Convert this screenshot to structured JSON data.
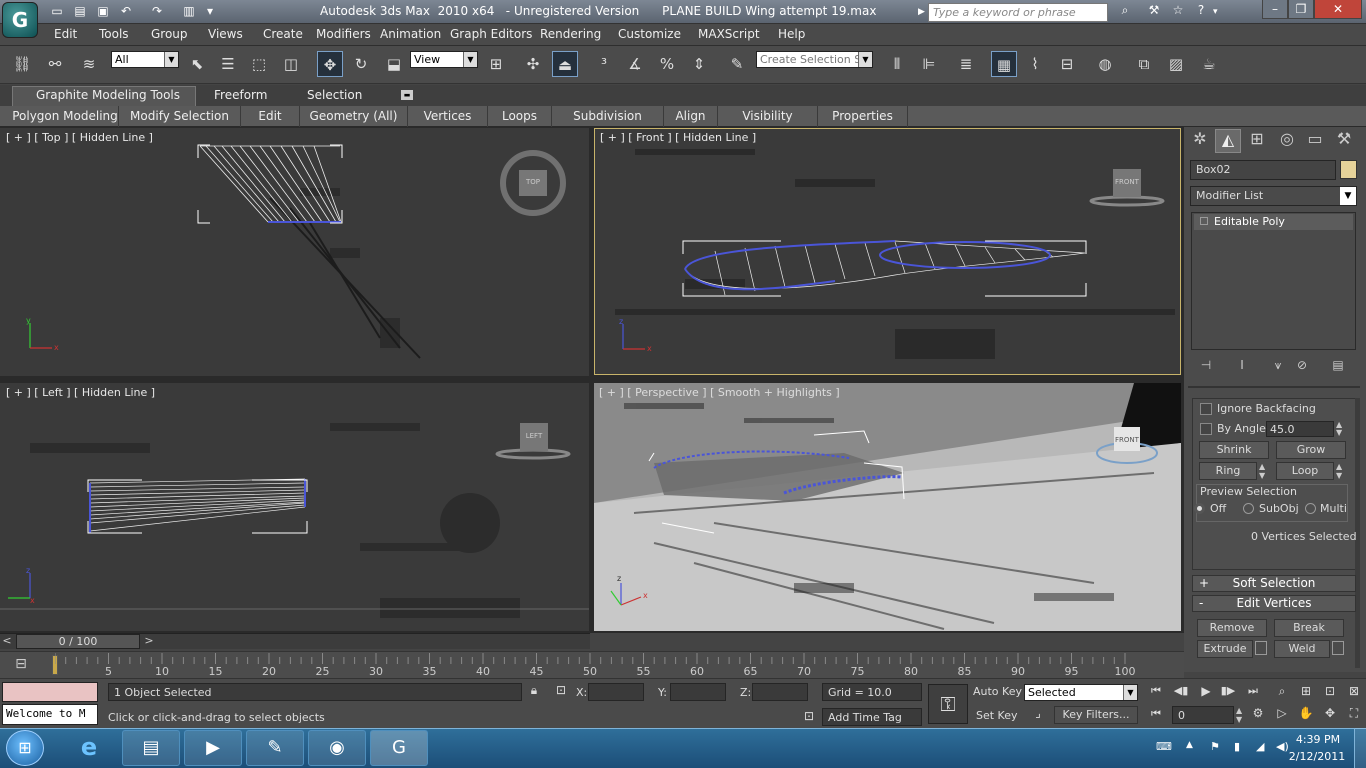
{
  "window": {
    "title": "Autodesk 3ds Max  2010 x64   - Unregistered Version      PLANE BUILD Wing attempt 19.max",
    "search_placeholder": "Type a keyword or phrase"
  },
  "menu": [
    "Edit",
    "Tools",
    "Group",
    "Views",
    "Create",
    "Modifiers",
    "Animation",
    "Graph Editors",
    "Rendering",
    "Customize",
    "MAXScript",
    "Help"
  ],
  "toolbar": {
    "filter_value": "All",
    "refcoord_value": "View",
    "selection_set_placeholder": "Create Selection Se"
  },
  "ribbon": {
    "tabs": [
      "Graphite Modeling Tools",
      "Freeform",
      "Selection"
    ],
    "panels": [
      "Polygon Modeling",
      "Modify Selection",
      "Edit",
      "Geometry (All)",
      "Vertices",
      "Loops",
      "Subdivision",
      "Align",
      "Visibility",
      "Properties"
    ]
  },
  "viewports": {
    "top": {
      "label": "[ + ] [ Top ] [ Hidden Line ]",
      "cube": "TOP"
    },
    "front": {
      "label": "[ + ] [ Front ] [ Hidden Line ]",
      "cube": "FRONT"
    },
    "left": {
      "label": "[ + ] [ Left ] [ Hidden Line ]",
      "cube": "LEFT"
    },
    "persp": {
      "label": "[ + ] [ Perspective ] [ Smooth + Highlights ]",
      "cube": "FRONT"
    }
  },
  "command_panel": {
    "object_name": "Box02",
    "modifier_list": "Modifier List",
    "stack_item": "Editable Poly",
    "ignore_backfacing": "Ignore Backfacing",
    "by_angle": "By Angle:",
    "by_angle_value": "45.0",
    "shrink": "Shrink",
    "grow": "Grow",
    "ring": "Ring",
    "loop": "Loop",
    "preview_selection": "Preview Selection",
    "preview_off": "Off",
    "preview_subobj": "SubObj",
    "preview_multi": "Multi",
    "vertices_selected": "0 Vertices Selected",
    "soft_selection": "Soft Selection",
    "edit_vertices": "Edit Vertices",
    "remove": "Remove",
    "break": "Break",
    "extrude": "Extrude",
    "weld": "Weld",
    "plus": "+",
    "minus": "-"
  },
  "timeline": {
    "frame_readout": "0 / 100",
    "ticks": [
      "5",
      "10",
      "15",
      "20",
      "25",
      "30",
      "35",
      "40",
      "45",
      "50",
      "55",
      "60",
      "65",
      "70",
      "75",
      "80",
      "85",
      "90",
      "95",
      "100"
    ]
  },
  "status": {
    "maxscript_text": "Welcome to M",
    "objects_selected": "1 Object Selected",
    "prompt": "Click or click-and-drag to select objects",
    "x_label": "X:",
    "y_label": "Y:",
    "z_label": "Z:",
    "grid": "Grid = 10.0",
    "add_time_tag": "Add Time Tag",
    "auto_key": "Auto Key",
    "set_key": "Set Key",
    "key_filters": "Key Filters...",
    "selected_value": "Selected",
    "frame_value": "0"
  },
  "taskbar": {
    "time": "4:39 PM",
    "date": "2/12/2011"
  },
  "colors": {
    "selection_blue": "#4a55d8",
    "viewport_active_border": "#c8b46a",
    "swatch": "#e6d39a"
  }
}
